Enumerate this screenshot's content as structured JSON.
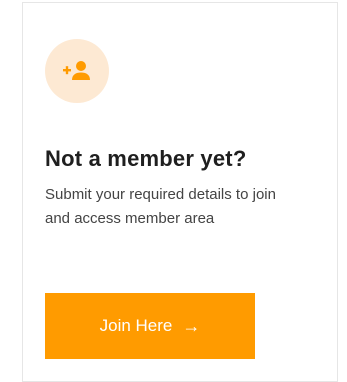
{
  "card": {
    "icon": "add-user-icon",
    "title": "Not a member yet?",
    "description": "Submit your required details to join and access member area",
    "button_label": "Join Here",
    "button_arrow": "→"
  },
  "colors": {
    "accent": "#ff9b00",
    "icon_bg": "#fde9d3",
    "title": "#1f1f1f",
    "text": "#444444",
    "border": "#e6e6e6"
  }
}
